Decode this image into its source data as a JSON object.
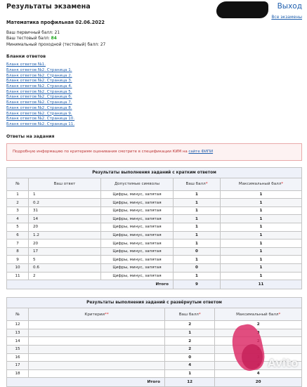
{
  "header": {
    "title": "Результаты экзамена",
    "exit_label": "Выход",
    "all_exams_link": "Все экзамены"
  },
  "exam": {
    "subject": "Математика профильная 02.06.2022",
    "primary_label": "Ваш первичный балл:",
    "primary_value": "21",
    "test_label": "Ваш тестовый балл:",
    "test_value": "84",
    "min_label": "Минимальный проходной (тестовый) балл:",
    "min_value": "27"
  },
  "blanks": {
    "heading": "Бланки ответов",
    "links": [
      "Бланк ответов №1.",
      "Бланк ответов №2. Страница 1.",
      "Бланк ответов №2. Страница 2.",
      "Бланк ответов №2. Страница 3.",
      "Бланк ответов №2. Страница 4.",
      "Бланк ответов №2. Страница 5.",
      "Бланк ответов №2. Страница 6.",
      "Бланк ответов №2. Страница 7.",
      "Бланк ответов №2. Страница 8.",
      "Бланк ответов №2. Страница 9.",
      "Бланк ответов №2. Страница 10.",
      "Бланк ответов №2. Страница 11."
    ]
  },
  "answers": {
    "heading": "Ответы на задания",
    "notice_text": "Подробную информацию по критериям оценивания смотрите в спецификации КИМ на",
    "notice_link": "сайте ФИПИ"
  },
  "short_table": {
    "caption": "Результаты выполнения заданий с кратким ответом",
    "headers": {
      "num": "№",
      "answer": "Ваш ответ",
      "allowed": "Допустимые символы",
      "score": "Ваш балл",
      "max": "Максимальный балл",
      "star": "*"
    },
    "rows": [
      {
        "n": "1",
        "ans": "1",
        "allowed": "Цифры, минус, запятая",
        "score": "1",
        "max": "1"
      },
      {
        "n": "2",
        "ans": "0.2",
        "allowed": "Цифры, минус, запятая",
        "score": "1",
        "max": "1"
      },
      {
        "n": "3",
        "ans": "31",
        "allowed": "Цифры, минус, запятая",
        "score": "1",
        "max": "1"
      },
      {
        "n": "4",
        "ans": "14",
        "allowed": "Цифры, минус, запятая",
        "score": "1",
        "max": "1"
      },
      {
        "n": "5",
        "ans": "20",
        "allowed": "Цифры, минус, запятая",
        "score": "1",
        "max": "1"
      },
      {
        "n": "6",
        "ans": "1.2",
        "allowed": "Цифры, минус, запятая",
        "score": "1",
        "max": "1"
      },
      {
        "n": "7",
        "ans": "20",
        "allowed": "Цифры, минус, запятая",
        "score": "1",
        "max": "1"
      },
      {
        "n": "8",
        "ans": "17",
        "allowed": "Цифры, минус, запятая",
        "score": "0",
        "max": "1"
      },
      {
        "n": "9",
        "ans": "5",
        "allowed": "Цифры, минус, запятая",
        "score": "1",
        "max": "1"
      },
      {
        "n": "10",
        "ans": "0.6",
        "allowed": "Цифры, минус, запятая",
        "score": "0",
        "max": "1"
      },
      {
        "n": "11",
        "ans": "2",
        "allowed": "Цифры, минус, запятая",
        "score": "1",
        "max": "1"
      }
    ],
    "total_label": "Итого",
    "total_score": "9",
    "total_max": "11"
  },
  "long_table": {
    "caption": "Результаты выполнения заданий с развёрнутым ответом",
    "headers": {
      "num": "№",
      "criteria": "Критерии",
      "criteria_star": "**",
      "score": "Ваш балл",
      "max": "Максимальный балл",
      "star": "*"
    },
    "rows": [
      {
        "n": "12",
        "score": "2",
        "max": "2"
      },
      {
        "n": "13",
        "score": "1",
        "max": "3"
      },
      {
        "n": "14",
        "score": "2",
        "max": "2"
      },
      {
        "n": "15",
        "score": "2",
        "max": "2"
      },
      {
        "n": "16",
        "score": "0",
        "max": "3"
      },
      {
        "n": "17",
        "score": "4",
        "max": "4"
      },
      {
        "n": "18",
        "score": "1",
        "max": "4"
      }
    ],
    "total_label": "Итого",
    "total_score": "12",
    "total_max": "20"
  },
  "watermark": {
    "text": "Avito"
  }
}
